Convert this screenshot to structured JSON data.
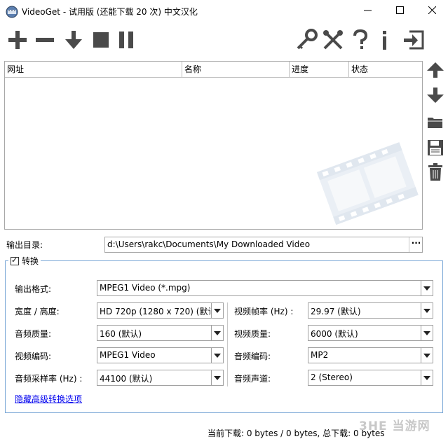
{
  "window": {
    "title": "VideoGet - 试用版 (还能下载 20 次) 中文汉化",
    "controls": [
      "minimize",
      "maximize",
      "close"
    ]
  },
  "toolbar": {
    "icons": [
      "add-icon",
      "remove-icon",
      "download-icon",
      "stop-icon",
      "pause-icon",
      "key-icon",
      "tools-icon",
      "help-icon",
      "info-icon",
      "exit-icon"
    ]
  },
  "list": {
    "columns": [
      "网址",
      "名称",
      "进度",
      "状态"
    ],
    "rows": []
  },
  "side_buttons": [
    "arrow-up-icon",
    "arrow-down-icon",
    "folder-icon",
    "save-icon",
    "trash-icon"
  ],
  "output_dir": {
    "label": "输出目录:",
    "value": "d:\\Users\\rakc\\Documents\\My Downloaded Video",
    "browse": "···"
  },
  "convert": {
    "checkbox_label": "转换",
    "checked": true,
    "format_label": "输出格式:",
    "format_value": "MPEG1 Video (*.mpg)",
    "size_label": "宽度 / 高度:",
    "size_value": "HD 720p (1280 x 720) (默认",
    "framerate_label": "视频帧率 (Hz) :",
    "framerate_value": "29.97 (默认)",
    "audio_quality_label": "音频质量:",
    "audio_quality_value": "160 (默认)",
    "video_quality_label": "视频质量:",
    "video_quality_value": "6000 (默认)",
    "video_codec_label": "视频编码:",
    "video_codec_value": "MPEG1 Video",
    "audio_codec_label": "音频编码:",
    "audio_codec_value": "MP2",
    "sample_rate_label": "音频采样率 (Hz) :",
    "sample_rate_value": "44100 (默认)",
    "channels_label": "音频声道:",
    "channels_value": "2 (Stereo)",
    "hide_link": "隐藏高级转换选项"
  },
  "status": {
    "text": "当前下载: 0 bytes / 0 bytes, 总下载: 0 bytes"
  },
  "corner_logo": "3HE 当游网",
  "colors": {
    "icon": "#4a4a4a",
    "group_border": "#7aa7d6",
    "link": "#0000ee"
  }
}
